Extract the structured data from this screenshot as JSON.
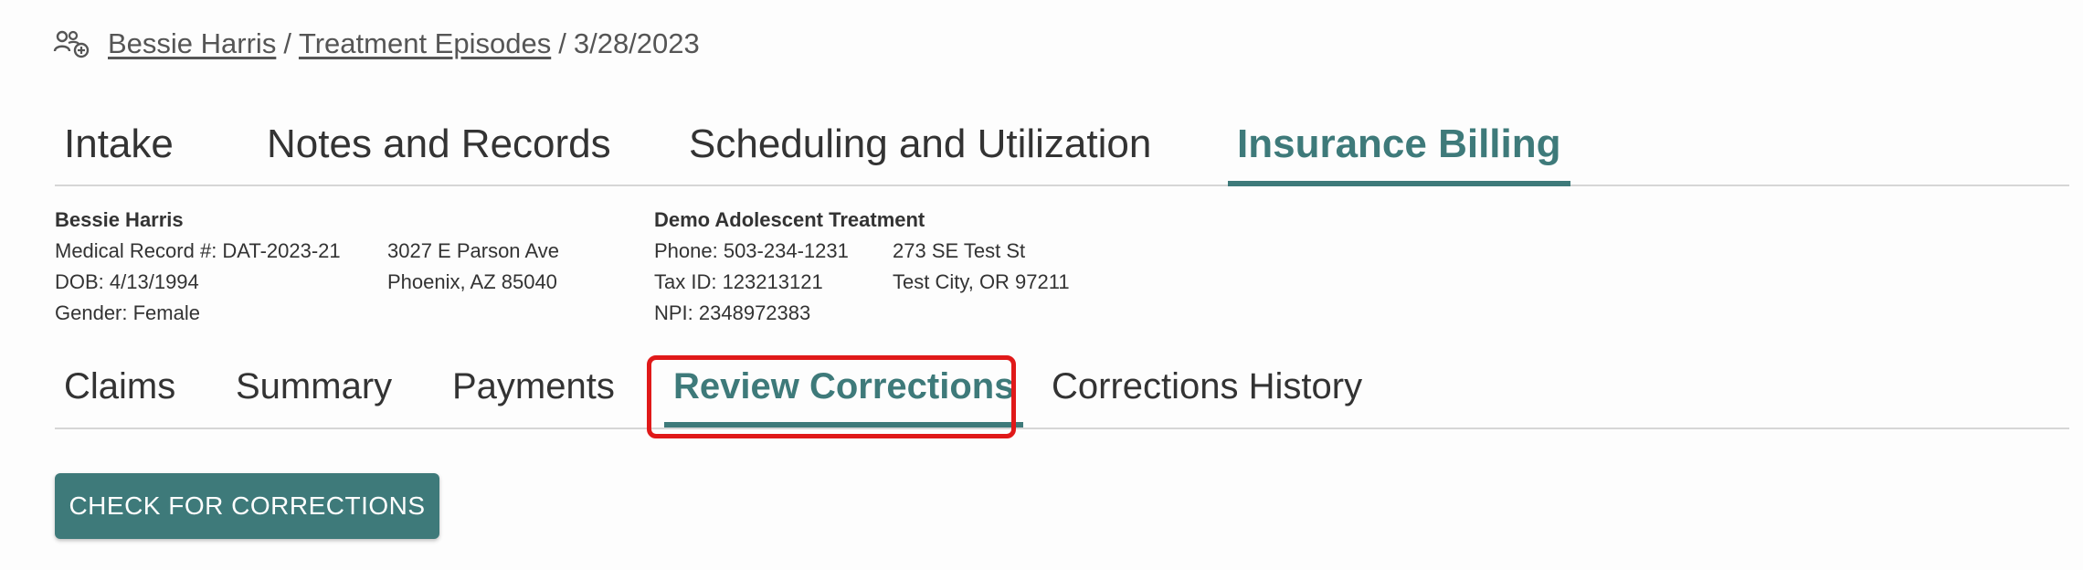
{
  "breadcrumb": {
    "icon": "user-group-add-icon",
    "patient": "Bessie Harris",
    "section": "Treatment Episodes",
    "date": "3/28/2023",
    "separator": "/"
  },
  "main_tabs": [
    {
      "label": "Intake",
      "active": false
    },
    {
      "label": "Notes and Records",
      "active": false
    },
    {
      "label": "Scheduling and Utilization",
      "active": false
    },
    {
      "label": "Insurance Billing",
      "active": true
    }
  ],
  "patient": {
    "name": "Bessie Harris",
    "mrn": "Medical Record #: DAT-2023-21",
    "dob": "DOB: 4/13/1994",
    "gender": "Gender: Female",
    "address_line1": "3027 E Parson Ave",
    "address_line2": "Phoenix, AZ 85040"
  },
  "provider": {
    "name": "Demo Adolescent Treatment",
    "phone": "Phone: 503-234-1231",
    "tax_id": "Tax ID: 123213121",
    "npi": "NPI: 2348972383",
    "address_line1": "273 SE Test St",
    "address_line2": "Test City, OR 97211"
  },
  "sub_tabs": [
    {
      "label": "Claims",
      "active": false
    },
    {
      "label": "Summary",
      "active": false
    },
    {
      "label": "Payments",
      "active": false
    },
    {
      "label": "Review Corrections",
      "active": true
    },
    {
      "label": "Corrections History",
      "active": false
    }
  ],
  "actions": {
    "check_corrections": "CHECK FOR CORRECTIONS"
  },
  "colors": {
    "accent": "#3e7a7a",
    "highlight": "#e01919"
  }
}
